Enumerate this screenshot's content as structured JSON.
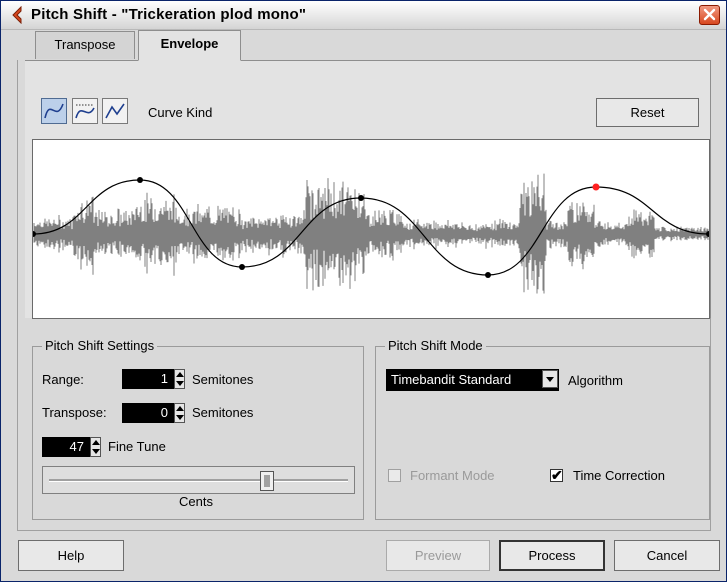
{
  "window": {
    "title": "Pitch Shift - \"Trickeration plod mono\"",
    "icons": {
      "app": "cubase-app-icon",
      "close": "close-icon"
    }
  },
  "tabs": [
    {
      "label": "Transpose",
      "active": false
    },
    {
      "label": "Envelope",
      "active": true
    }
  ],
  "envelope": {
    "curve_kind_label": "Curve Kind",
    "curve_kinds": [
      "spline-curve-icon",
      "damped-spline-curve-icon",
      "linear-curve-icon"
    ],
    "active_curve_kind": 0,
    "reset_label": "Reset",
    "colors": {
      "waveform": "#808080",
      "node": "#000000",
      "selected_node": "#ff2020",
      "curve": "#000000"
    }
  },
  "pitch_shift_settings": {
    "title": "Pitch Shift Settings",
    "range_label": "Range:",
    "range_value": "1",
    "range_unit": "Semitones",
    "transpose_label": "Transpose:",
    "transpose_value": "0",
    "transpose_unit": "Semitones",
    "fine_tune_value": "47",
    "fine_tune_label": "Fine Tune",
    "cents_label": "Cents",
    "cents_slider_level": 0.73
  },
  "pitch_shift_mode": {
    "title": "Pitch Shift Mode",
    "algorithm_value": "Timebandit Standard",
    "algorithm_label": "Algorithm",
    "formant_mode_label": "Formant Mode",
    "formant_mode_checked": false,
    "formant_mode_enabled": false,
    "time_correction_label": "Time Correction",
    "time_correction_checked": true
  },
  "footer": {
    "help_label": "Help",
    "preview_label": "Preview",
    "process_label": "Process",
    "cancel_label": "Cancel"
  }
}
